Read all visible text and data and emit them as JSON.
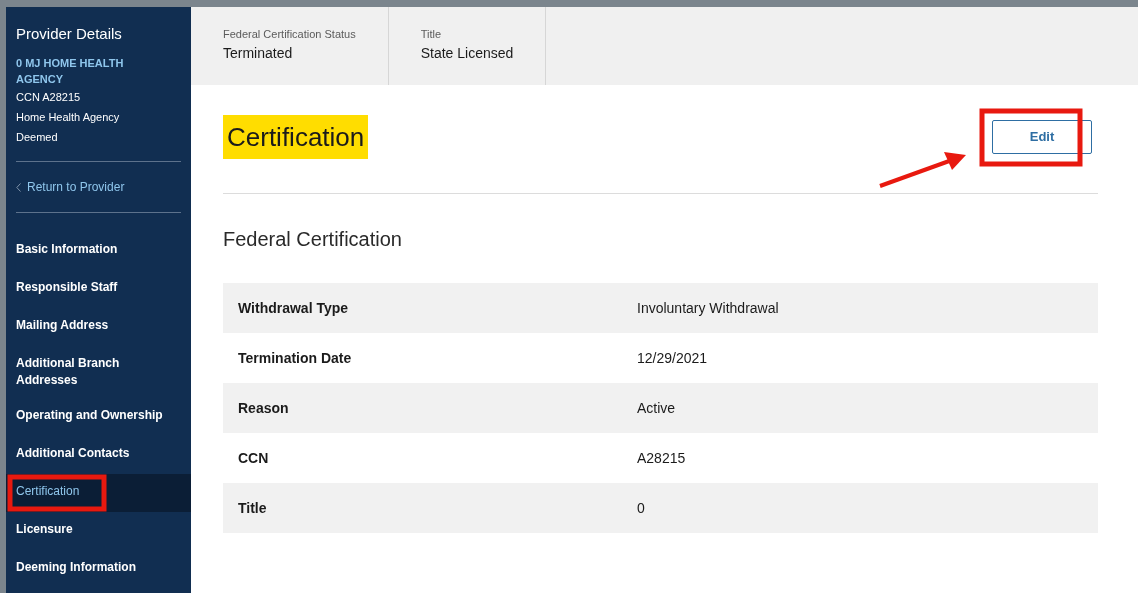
{
  "sidebar": {
    "title": "Provider Details",
    "provider_name": "0 MJ HOME HEALTH AGENCY",
    "details": [
      "CCN A28215",
      "Home Health Agency",
      "Deemed"
    ],
    "back_link": "Return to Provider",
    "items": [
      {
        "label": "Basic Information",
        "selected": false
      },
      {
        "label": "Responsible Staff",
        "selected": false
      },
      {
        "label": "Mailing Address",
        "selected": false
      },
      {
        "label": "Additional Branch Addresses",
        "selected": false
      },
      {
        "label": "Operating and Ownership",
        "selected": false
      },
      {
        "label": "Additional Contacts",
        "selected": false
      },
      {
        "label": "Certification",
        "selected": true
      },
      {
        "label": "Licensure",
        "selected": false
      },
      {
        "label": "Deeming Information",
        "selected": false
      }
    ]
  },
  "summary": [
    {
      "label": "Federal Certification Status",
      "value": "Terminated"
    },
    {
      "label": "Title",
      "value": "State Licensed"
    }
  ],
  "page_title": "Certification",
  "edit_button": "Edit",
  "section_title": "Federal Certification",
  "rows": [
    {
      "label": "Withdrawal Type",
      "value": "Involuntary Withdrawal"
    },
    {
      "label": "Termination Date",
      "value": "12/29/2021"
    },
    {
      "label": "Reason",
      "value": "Active"
    },
    {
      "label": "CCN",
      "value": "A28215"
    },
    {
      "label": "Title",
      "value": "0"
    }
  ]
}
